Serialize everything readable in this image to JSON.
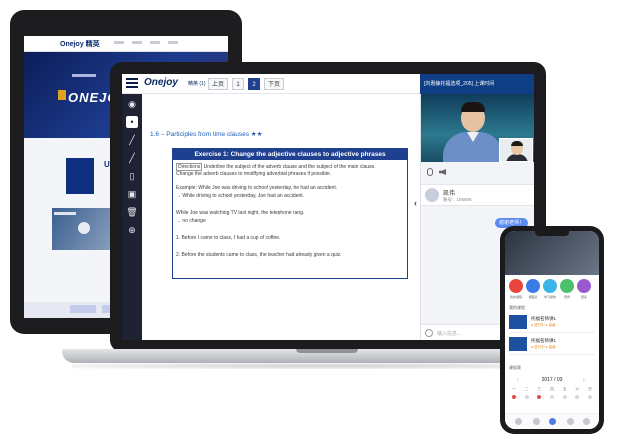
{
  "laptop": {
    "logo": "Onejoy",
    "logo_sub": "精英 (1)",
    "pages": [
      "上页",
      "1",
      "2",
      "下页"
    ],
    "active_page": "2",
    "live_bar": "[刘惠静托福选项_205] 上课时间",
    "toolbar_icons": [
      "menu-icon",
      "eye-icon",
      "dot-tool-icon",
      "pen-icon",
      "brush-icon",
      "document-icon",
      "sticker-icon",
      "trash-icon",
      "add-icon"
    ],
    "doc_heading": "1.6 – Participles from time clauses ★★",
    "exercise": {
      "title": "Exercise 1: Change the adjective clauses to adjective phrases",
      "directions_tag": "Directions",
      "lines": [
        "Underline the subject of the adverb clause and the subject of the main clause.",
        "Change the adverb clauses to modifying adverbial phrases if possible.",
        "Example: While Joe was driving to school yesterday, he had an accident.",
        "→ While driving to school yesterday, Joe had an accident.",
        "While Joe was watching TV last night, the telephone rang.",
        "→ no change",
        "1.     Before I came to class, I had a cup of coffee.",
        "2.     Before the students came to class, the teacher had already given a quiz."
      ]
    },
    "student": {
      "name": "凯伟",
      "id": "账号：105506"
    },
    "chat_bubble": "谢谢老师！",
    "chat_placeholder": "输入信息..."
  },
  "phone": {
    "icon_labels": [
      "我的课程",
      "课程表",
      "学习报告",
      "老师",
      "更多"
    ],
    "icon_colors": [
      "#e8453c",
      "#3b7be8",
      "#3bb5e8",
      "#4cc06a",
      "#9b59d0"
    ],
    "section_recent": "我的课程",
    "courses": [
      {
        "title": "托福名师讲1",
        "meta": "● 进行中 ● 高级"
      },
      {
        "title": "托福名师讲1",
        "meta": "● 进行中 ● 高级"
      }
    ],
    "section_calendar": "课程表",
    "calendar_month": "2017 / 03",
    "calendar_days": [
      "一",
      "二",
      "三",
      "四",
      "五",
      "六",
      "日"
    ]
  },
  "tablet": {
    "logo": "Onejoy 精英",
    "hero_text": "ONEJOY 精英"
  },
  "colors": {
    "brand_blue": "#1f3f8f",
    "live_bar": "#0e3f86",
    "chat_bubble": "#5b8bf0",
    "heading_blue": "#1e5fb8"
  }
}
